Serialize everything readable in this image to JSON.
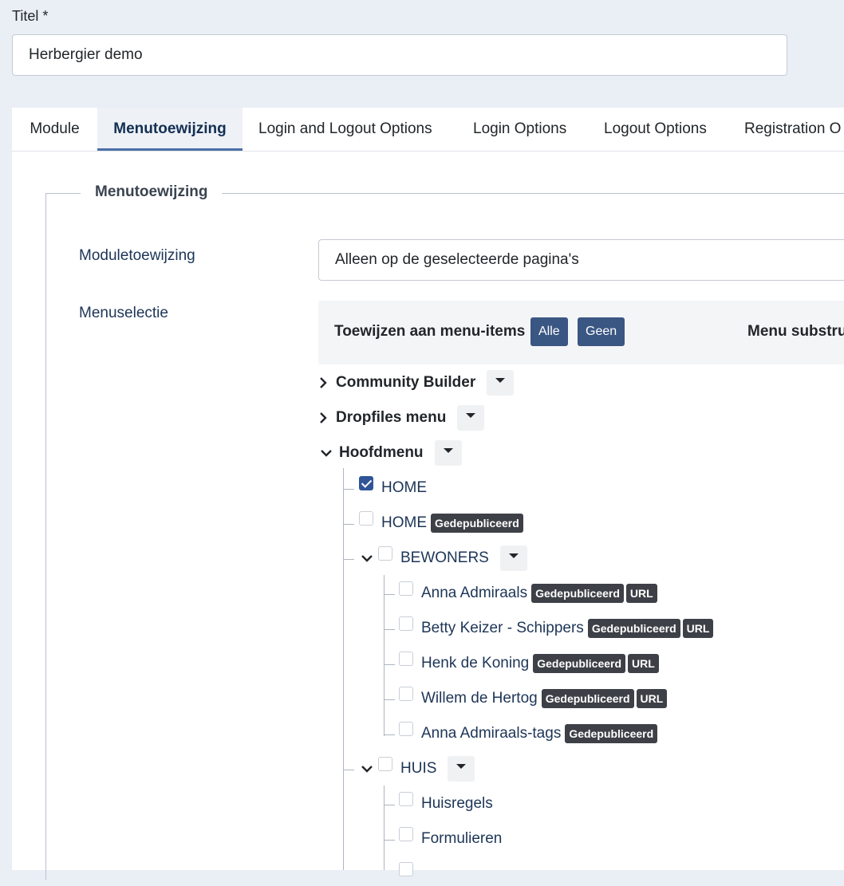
{
  "title_field": {
    "label": "Titel *",
    "value": "Herbergier demo"
  },
  "tabs": [
    {
      "label": "Module"
    },
    {
      "label": "Menutoewijzing",
      "active": true
    },
    {
      "label": "Login and Logout Options"
    },
    {
      "label": "Login Options"
    },
    {
      "label": "Logout Options"
    },
    {
      "label": "Registration O"
    }
  ],
  "fieldset": {
    "legend": "Menutoewijzing",
    "module_assignment": {
      "label": "Moduletoewijzing",
      "value": "Alleen op de geselecteerde pagina's"
    },
    "menu_selection": {
      "label": "Menuselectie",
      "assign_title": "Toewijzen aan menu-items",
      "btn_all": "Alle",
      "btn_none": "Geen",
      "sub_title": "Menu substru"
    }
  },
  "tree": {
    "menus": [
      "Community Builder",
      "Dropfiles menu",
      "Hoofdmenu"
    ],
    "items": {
      "home1": "HOME",
      "home2": "HOME",
      "bewoners": "BEWONERS",
      "anna": "Anna Admiraals",
      "betty": "Betty Keizer - Schippers",
      "henk": "Henk de Koning",
      "willem": "Willem de Hertog",
      "anna_tags": "Anna Admiraals-tags",
      "huis": "HUIS",
      "huisregels": "Huisregels",
      "formulieren": "Formulieren"
    },
    "badges": {
      "published": "Gedepubliceerd",
      "url": "URL"
    }
  }
}
